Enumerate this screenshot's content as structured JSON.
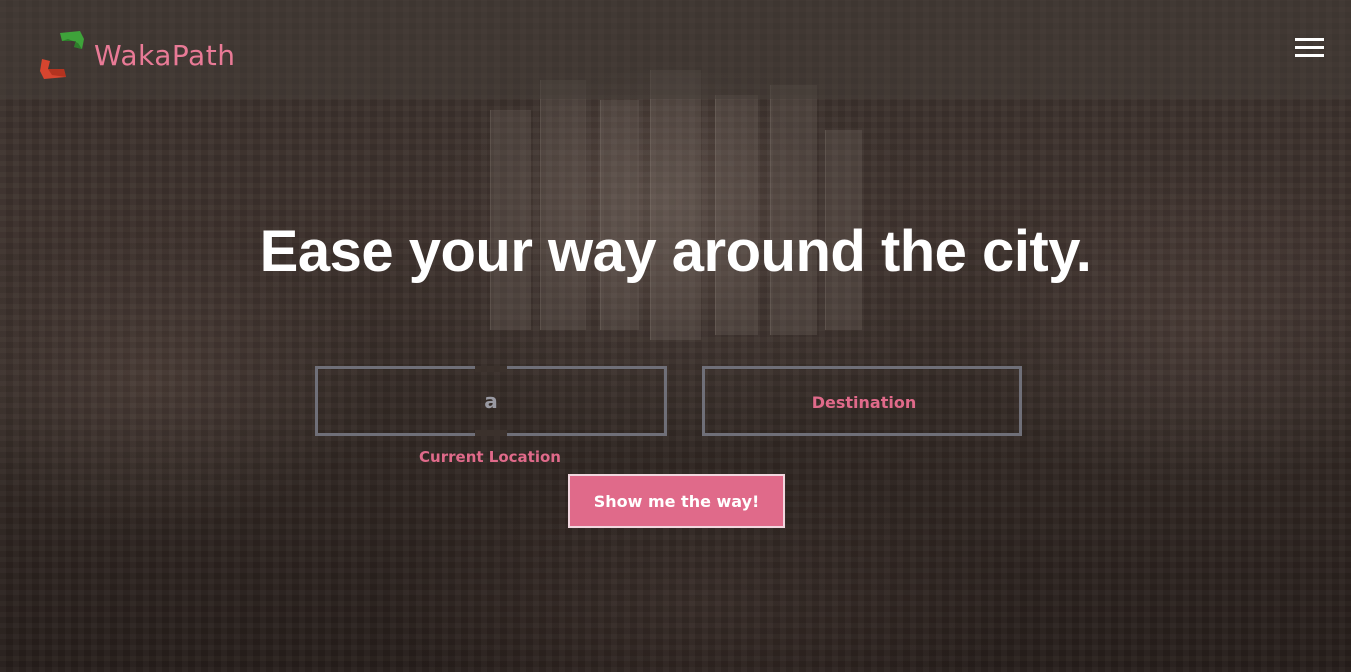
{
  "app": {
    "brand_name": "WakaPath",
    "brand_color": "#e97a96",
    "logo_icon": "green-red-chevron-logo"
  },
  "navbar": {
    "menu_icon": "hamburger-menu-icon"
  },
  "hero": {
    "headline": "Ease your way around the city."
  },
  "form": {
    "current_location": {
      "value": "a",
      "label": "Current Location"
    },
    "destination": {
      "value": "",
      "placeholder": "Destination"
    },
    "submit_label": "Show me the way!"
  },
  "colors": {
    "accent": "#e06a8a",
    "field_border": "#6f6f78"
  }
}
